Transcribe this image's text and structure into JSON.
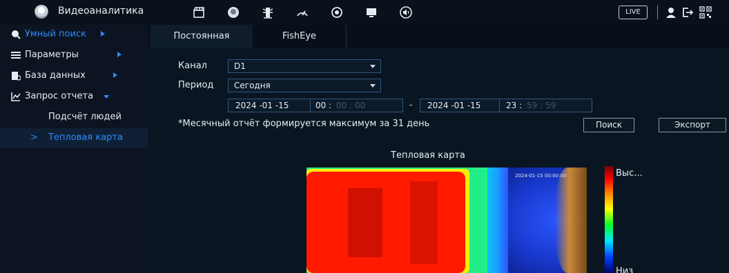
{
  "app": {
    "title": "Видеоаналитика",
    "icon": "face-recognition-icon",
    "live_label": "LIVE"
  },
  "toolbar_icons": [
    "film-clapper-icon",
    "face-icon",
    "traffic-light-icon",
    "speedometer-icon",
    "refresh-icon",
    "monitor-icon",
    "speaker-icon"
  ],
  "user_icons": [
    "user-icon",
    "logout-icon",
    "qr-code-icon"
  ],
  "sidebar": {
    "items": [
      {
        "label": "Умный поиск",
        "icon": "smart-search-icon",
        "active": true
      },
      {
        "label": "Параметры",
        "icon": "list-icon"
      },
      {
        "label": "База данных",
        "icon": "database-icon"
      },
      {
        "label": "Запрос отчета",
        "icon": "chart-icon",
        "expanded": true
      }
    ],
    "subitems": [
      {
        "label": "Подсчёт людей"
      },
      {
        "label": "Тепловая карта",
        "selected": true,
        "marker": ">"
      }
    ]
  },
  "tabs": [
    {
      "label": "Постоянная",
      "active": true
    },
    {
      "label": "FishEye"
    }
  ],
  "form": {
    "channel_label": "Канал",
    "channel_value": "D1",
    "period_label": "Период",
    "period_value": "Сегодня",
    "start_date": "2024 -01 -15",
    "start_time_h": "00 :",
    "start_time_ms": "00 : 00",
    "range_sep": "-",
    "end_date": "2024 -01 -15",
    "end_time_h": "23 :",
    "end_time_ms": "59 : 59",
    "note": "*Месячный отчёт формируется максимум за 31 день",
    "search_button": "Поиск",
    "export_button": "Экспорт"
  },
  "heatmap": {
    "title": "Тепловая карта",
    "camera_stamp": "2024-01-15 00:00:00",
    "legend_high": "Выс...",
    "legend_low": "Низ"
  },
  "colors": {
    "accent": "#2e8bff",
    "hot": "#ff1a00",
    "warm": "#ffff00",
    "mid": "#00ff90",
    "cool": "#1b3db8"
  }
}
